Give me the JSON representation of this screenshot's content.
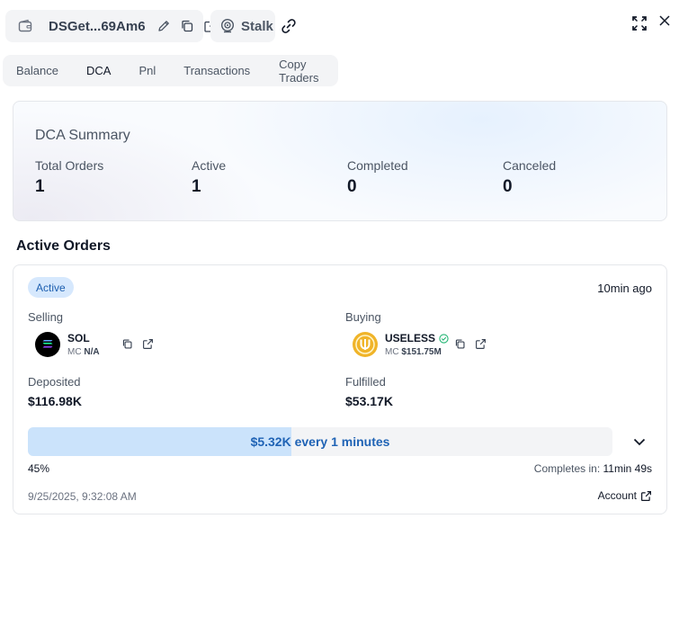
{
  "header": {
    "wallet_name": "DSGet...69Am6",
    "stalk_label": "Stalk"
  },
  "tabs": [
    {
      "label": "Balance",
      "active": false
    },
    {
      "label": "DCA",
      "active": true
    },
    {
      "label": "Pnl",
      "active": false
    },
    {
      "label": "Transactions",
      "active": false
    },
    {
      "label": "Copy Traders",
      "active": false
    }
  ],
  "summary": {
    "title": "DCA Summary",
    "stats": [
      {
        "label": "Total Orders",
        "value": "1"
      },
      {
        "label": "Active",
        "value": "1"
      },
      {
        "label": "Completed",
        "value": "0"
      },
      {
        "label": "Canceled",
        "value": "0"
      }
    ]
  },
  "active_orders": {
    "title": "Active Orders",
    "order": {
      "status": "Active",
      "time_ago": "10min ago",
      "selling_label": "Selling",
      "buying_label": "Buying",
      "selling_token": {
        "symbol": "SOL",
        "mc_label": "MC",
        "mc_value": "N/A"
      },
      "buying_token": {
        "symbol": "USELESS",
        "mc_label": "MC",
        "mc_value": "$151.75M"
      },
      "deposited_label": "Deposited",
      "deposited_value": "$116.98K",
      "fulfilled_label": "Fulfilled",
      "fulfilled_value": "$53.17K",
      "progress_text": "$5.32K every 1 minutes",
      "progress_fraction": 0.45,
      "progress_pct_label": "45%",
      "completes_label": "Completes in:",
      "completes_value": "11min 49s",
      "date": "9/25/2025, 9:32:08 AM",
      "account_label": "Account"
    }
  },
  "colors": {
    "accent": "#1f63b5",
    "badge_bg": "#d6e8fd",
    "progress_fill": "#cbe3fb",
    "verified": "#22b573",
    "useless_gold": "#f0b429"
  },
  "icons": [
    "wallet-icon",
    "pencil-icon",
    "copy-icon",
    "external-link-icon",
    "stalk-icon",
    "link-icon",
    "expand-icon",
    "close-icon",
    "verified-icon",
    "chevron-down-icon"
  ]
}
